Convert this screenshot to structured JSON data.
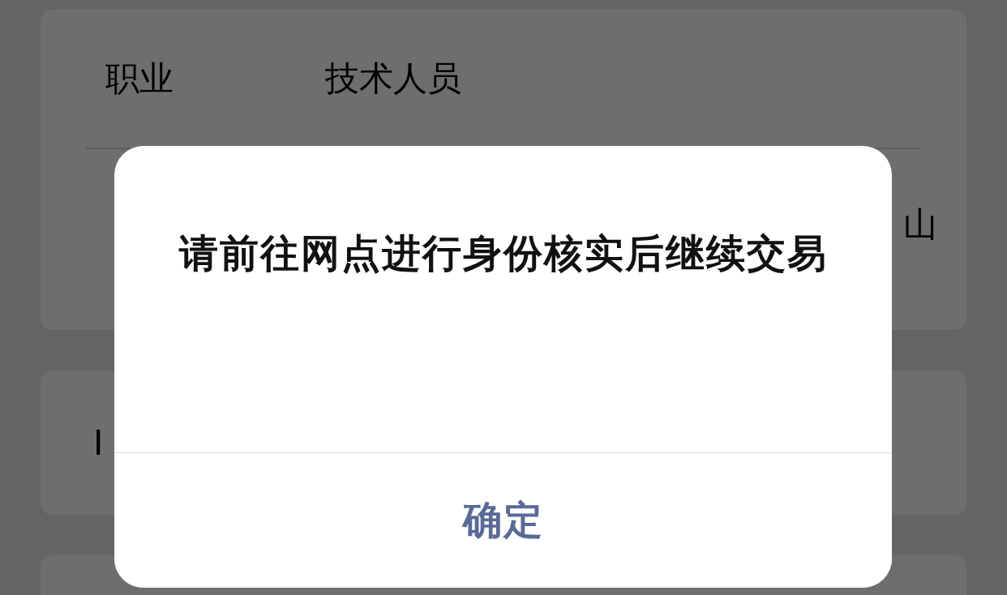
{
  "background_card": {
    "rows": [
      {
        "label": "职业",
        "value": "技术人员"
      },
      {
        "value": "山"
      }
    ]
  },
  "second_card": {
    "text": "I"
  },
  "dialog": {
    "message": "请前往网点进行身份核实后继续交易",
    "button": "确定"
  }
}
